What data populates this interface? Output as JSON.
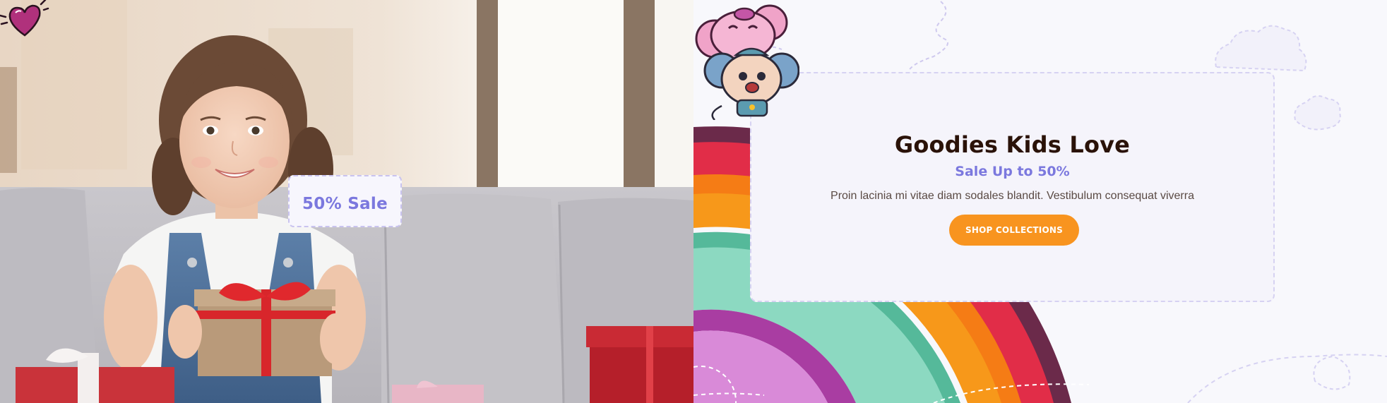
{
  "hero": {
    "badge_text": "50% Sale"
  },
  "promo": {
    "title": "Goodies Kids Love",
    "subtitle": "Sale Up to 50%",
    "description": "Proin lacinia mi vitae diam sodales blandit. Vestibulum consequat viverra",
    "button_label": "SHOP COLLECTIONS"
  },
  "colors": {
    "accent_purple": "#7b78de",
    "button_orange": "#f8941f",
    "title_dark": "#2a1208"
  },
  "icons": {
    "badge": "heart-icon",
    "decor": [
      "cloud-icon",
      "rainbow-graphic",
      "mouse-mascots"
    ]
  }
}
